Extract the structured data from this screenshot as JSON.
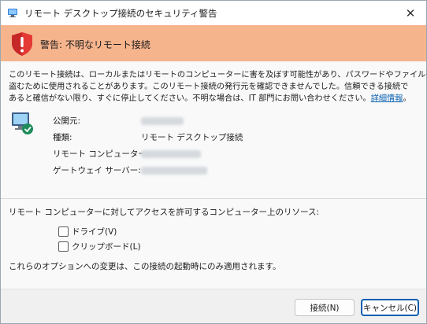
{
  "window": {
    "title": "リモート デスクトップ接続のセキュリティ警告",
    "close_glyph": "✕"
  },
  "banner": {
    "title": "警告: 不明なリモート接続",
    "background": "#f6b48d"
  },
  "description": {
    "line1": "このリモート接続は、ローカルまたはリモートのコンピューターに害を及ぼす可能性があり、パスワードやファイルを",
    "line2": "盗むために使用されることがあります。このリモート接続の発行元を確認できませんでした。信頼できる接続で",
    "line3_prefix": "あると確信がない限り、すぐに停止してください。不明な場合は、IT 部門にお問い合わせください。",
    "link": "詳細情報",
    "line3_suffix": "。"
  },
  "details": {
    "publisher_label": "公開元:",
    "type_label": "種類:",
    "type_value": "リモート デスクトップ接続",
    "remote_computer_label": "リモート コンピューター:",
    "gateway_label": "ゲートウェイ サーバー:"
  },
  "resources": {
    "label": "リモート コンピューターに対してアクセスを許可するコンピューター上のリソース:",
    "options": [
      {
        "label": "ドライブ(V)",
        "checked": false
      },
      {
        "label": "クリップボード(L)",
        "checked": false
      }
    ]
  },
  "note": "これらのオプションへの変更は、この接続の起動時にのみ適用されます。",
  "buttons": {
    "connect": "接続(N)",
    "cancel": "キャンセル(C)"
  },
  "colors": {
    "link": "#0b61b0",
    "default_button_border": "#0d5fb0"
  },
  "icons": {
    "app": "rdp-app-icon",
    "warning": "warning-shield-icon",
    "computer": "remote-computer-icon"
  }
}
